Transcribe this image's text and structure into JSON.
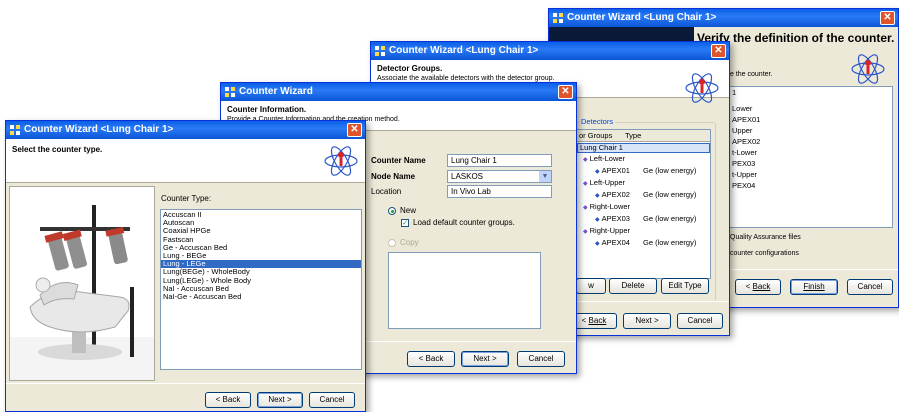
{
  "win4": {
    "title": "Counter Wizard <Lung Chair 1>",
    "heading": "Verify the definition of the counter.",
    "sub": "e the counter.",
    "box_first": "1",
    "box_lines": [
      "Lower",
      "APEX01",
      "Upper",
      "APEX02",
      "t-Lower",
      "PEX03",
      "t-Upper",
      "PEX04"
    ],
    "check1": "Quality Assurance files",
    "check2": "counter configurations",
    "back": "Back",
    "finish": "Finish",
    "cancel": "Cancel"
  },
  "win3": {
    "title": "Counter Wizard <Lung Chair 1>",
    "heading": "Detector Groups.",
    "sub": "Associate the available detectors with the detector group.",
    "group_title": "Detectors",
    "col_groups": "or Groups",
    "col_type": "Type",
    "tree_root": "Lung Chair 1",
    "tree": [
      {
        "group": "Left-Lower",
        "det": "APEX01",
        "type": "Ge (low energy)"
      },
      {
        "group": "Left-Upper",
        "det": "APEX02",
        "type": "Ge (low energy)"
      },
      {
        "group": "Right-Lower",
        "det": "APEX03",
        "type": "Ge (low energy)"
      },
      {
        "group": "Right-Upper",
        "det": "APEX04",
        "type": "Ge (low energy)"
      }
    ],
    "btn_w": "w",
    "delete": "Delete",
    "edit_type": "Edit Type",
    "back": "Back",
    "next": "Next >",
    "cancel": "Cancel"
  },
  "win2": {
    "title": "Counter Wizard",
    "heading": "Counter Information.",
    "sub": "Provide a Counter Information and the creation method.",
    "counter_name_label": "Counter Name",
    "counter_name_value": "Lung Chair 1",
    "node_name_label": "Node Name",
    "node_name_value": "LASKOS",
    "location_label": "Location",
    "location_value": "In Vivo Lab",
    "radio_new": "New",
    "check_load": "Load default counter groups.",
    "radio_copy": "Copy",
    "back": "< Back",
    "next": "Next >",
    "cancel": "Cancel"
  },
  "win1": {
    "title": "Counter Wizard <Lung Chair 1>",
    "heading": "Select the counter type.",
    "list_label": "Counter Type:",
    "counter_types": [
      "Accuscan II",
      "Autoscan",
      "Coaxial HPGe",
      "Fastscan",
      "Ge - Accuscan Bed",
      "Lung - BEGe",
      "Lung - LEGe",
      "Lung(BEGe) - WholeBody",
      "Lung(LEGe) - Whole Body",
      "NaI - Accuscan Bed",
      "NaI-Ge - Accuscan Bed"
    ],
    "selected_index": 6,
    "back": "< Back",
    "next": "Next >",
    "cancel": "Cancel"
  },
  "colors": {
    "title_blue": "#0a5fe8",
    "selection": "#316ac5",
    "close_red": "#e0542b"
  }
}
